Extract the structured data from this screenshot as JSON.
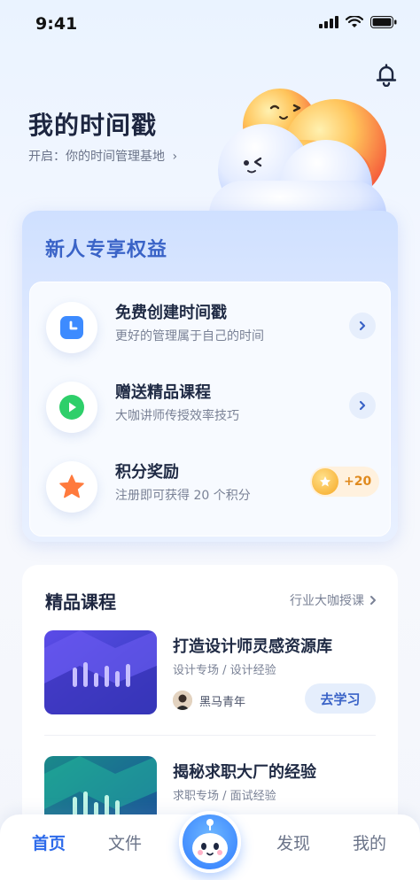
{
  "status_bar": {
    "time": "9:41"
  },
  "header": {
    "title": "我的时间戳",
    "subtitle": "开启：你的时间管理基地"
  },
  "benefits": {
    "title": "新人专享权益",
    "items": [
      {
        "title": "免费创建时间戳",
        "desc": "更好的管理属于自己的时间",
        "icon": "clock-icon"
      },
      {
        "title": "赠送精品课程",
        "desc": "大咖讲师传授效率技巧",
        "icon": "play-icon"
      },
      {
        "title": "积分奖励",
        "desc": "注册即可获得 20 个积分",
        "icon": "star-icon",
        "points": "+20"
      }
    ]
  },
  "courses": {
    "title": "精品课程",
    "more_label": "行业大咖授课",
    "items": [
      {
        "title": "打造设计师灵感资源库",
        "tags": "设计专场 / 设计经验",
        "author": "黑马青年",
        "button": "去学习"
      },
      {
        "title": "揭秘求职大厂的经验",
        "tags": "求职专场 / 面试经验"
      }
    ]
  },
  "tabbar": {
    "tabs": [
      {
        "label": "首页",
        "active": true
      },
      {
        "label": "文件"
      },
      {
        "label": "发现"
      },
      {
        "label": "我的"
      }
    ]
  },
  "colors": {
    "accent": "#2e6bea",
    "benefit_title": "#3a63c7",
    "points": "#e08a1e"
  }
}
